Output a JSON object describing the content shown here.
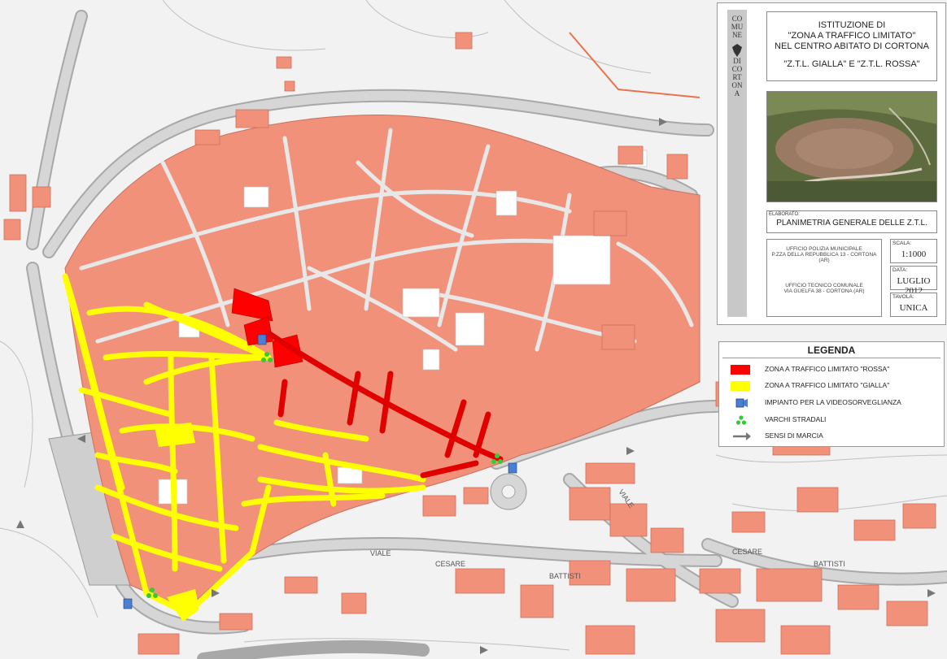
{
  "title_block": {
    "emblem_letters": [
      "CO",
      "MU",
      "NE",
      "DI",
      "CO",
      "RT",
      "ON",
      "A"
    ],
    "title_lines": [
      "ISTITUZIONE DI",
      "\"ZONA A TRAFFICO LIMITATO\"",
      "NEL CENTRO ABITATO DI CORTONA"
    ],
    "subtitle": "\"Z.T.L. GIALLA\" E \"Z.T.L. ROSSA\"",
    "elaborato_key": "ELABORATO:",
    "elaborato_value": "PLANIMETRIA GENERALE DELLE Z.T.L.",
    "office_1_line1": "UFFICIO POLIZIA MUNICIPALE",
    "office_1_line2": "P.ZZA DELLA REPUBBLICA 13 - CORTONA (AR)",
    "office_2_line1": "UFFICIO TECNICO COMUNALE",
    "office_2_line2": "VIA GUELFA 38 - CORTONA (AR)",
    "scala_key": "SCALA:",
    "scala_value": "1:1000",
    "data_key": "DATA:",
    "data_value": "LUGLIO 2012",
    "tavola_key": "TAVOLA:",
    "tavola_value": "UNICA"
  },
  "legend": {
    "title": "LEGENDA",
    "items": [
      {
        "label": "ZONA A TRAFFICO LIMITATO \"ROSSA\"",
        "color": "#ff0000",
        "icon": "red-zone-swatch"
      },
      {
        "label": "ZONA A TRAFFICO LIMITATO \"GIALLA\"",
        "color": "#ffff00",
        "icon": "yellow-zone-swatch"
      },
      {
        "label": "IMPIANTO PER LA VIDEOSORVEGLIANZA",
        "color": "#4a7fd4",
        "icon": "camera-icon"
      },
      {
        "label": "VARCHI STRADALI",
        "color": "#33cc33",
        "icon": "gate-icon"
      },
      {
        "label": "SENSI DI MARCIA",
        "color": "#777777",
        "icon": "arrow-icon"
      }
    ]
  },
  "map_labels": {
    "viale_1": "VIALE",
    "cesare_1": "CESARE",
    "battisti_1": "BATTISTI",
    "viale_2": "VIALE",
    "cesare_2": "CESARE",
    "battisti_2": "BATTISTI"
  },
  "colors": {
    "building": "#f2917a",
    "building_stroke": "#c8705c",
    "road": "#cfcfcf",
    "road_edge": "#9a9a9a",
    "background": "#f2f2f2",
    "red_zone": "#ff0000",
    "yellow_zone": "#ffff00"
  }
}
